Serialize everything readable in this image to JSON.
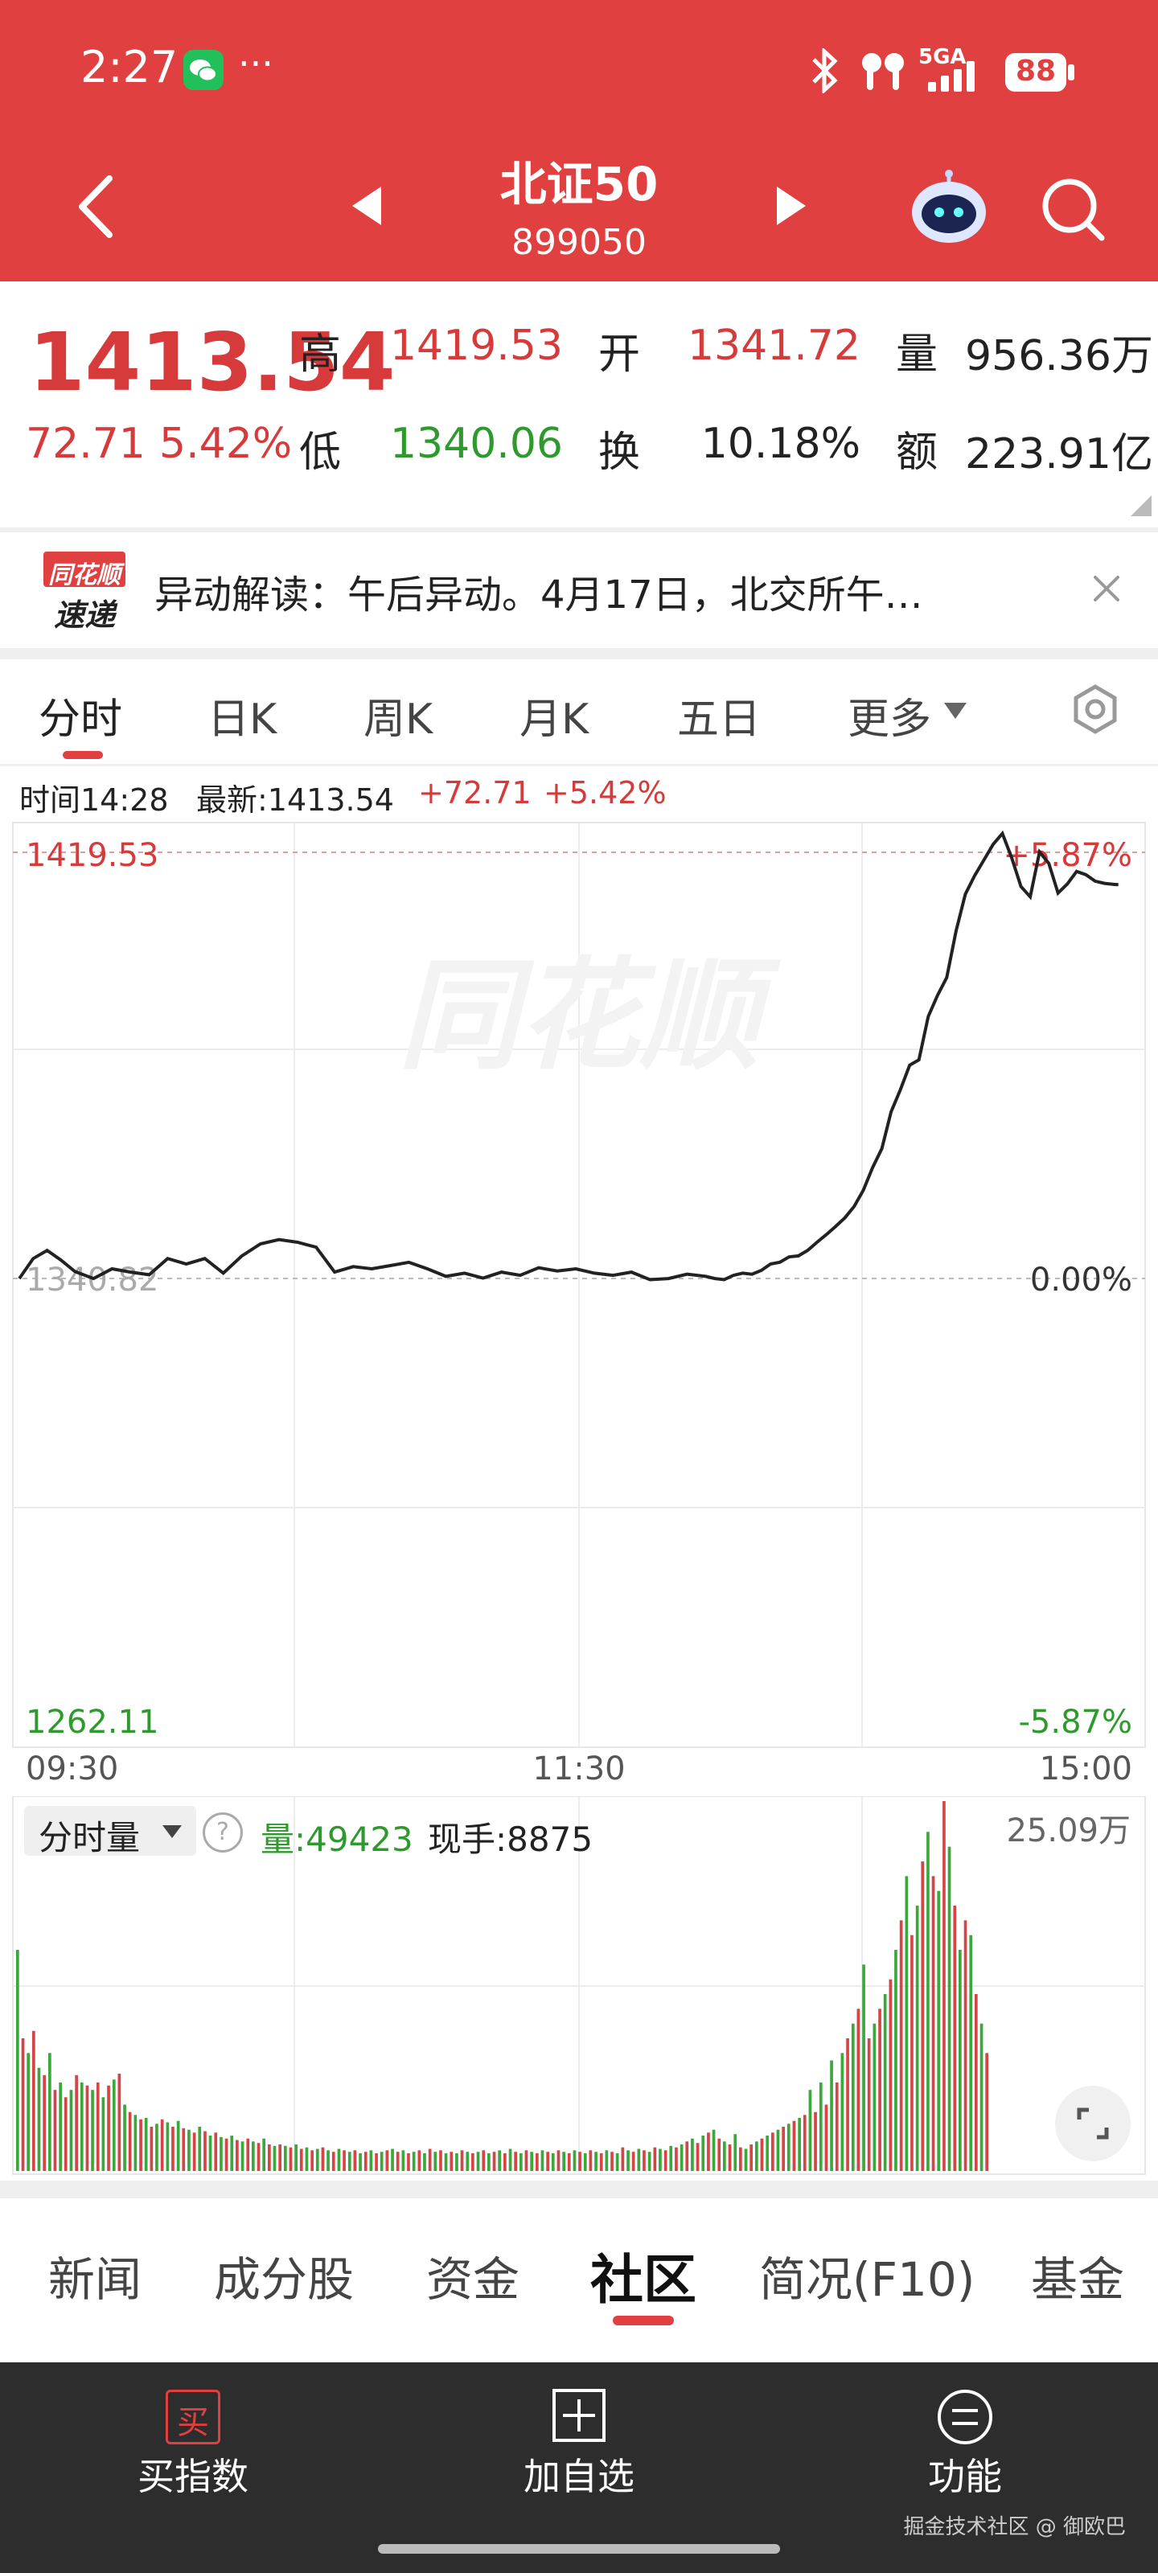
{
  "status_bar": {
    "time": "2:27",
    "more": "···",
    "network": "5GA",
    "battery": "88"
  },
  "header": {
    "title": "北证50",
    "code": "899050"
  },
  "quote": {
    "price": "1413.54",
    "change": "72.71",
    "change_pct": "5.42%",
    "high_label": "高",
    "high": "1419.53",
    "open_label": "开",
    "open": "1341.72",
    "volume_label": "量",
    "volume": "956.36万",
    "low_label": "低",
    "low": "1340.06",
    "turnover_label": "换",
    "turnover": "10.18%",
    "amount_label": "额",
    "amount": "223.91亿"
  },
  "news_banner": {
    "logo_top": "同花顺",
    "logo_bottom": "速递",
    "text": "异动解读：午后异动。4月17日，北交所午…"
  },
  "chart_tabs": [
    "分时",
    "日K",
    "周K",
    "月K",
    "五日",
    "更多"
  ],
  "chart_info": {
    "time": "时间14:28",
    "latest": "最新:1413.54",
    "change": "+72.71",
    "change_pct": "+5.42%"
  },
  "watermark": "同花顺",
  "chart_data": {
    "type": "line",
    "x_ticks": [
      "09:30",
      "11:30",
      "15:00"
    ],
    "y_left_top": "1419.53",
    "y_left_mid": "1340.82",
    "y_left_bottom": "1262.11",
    "y_right_top": "+5.87%",
    "y_right_mid": "0.00%",
    "y_right_bottom": "-5.87%",
    "ylim": [
      1262.11,
      1419.53
    ],
    "baseline": 1340.82,
    "x": [
      0,
      3,
      6,
      9,
      12,
      16,
      20,
      24,
      28,
      32,
      36,
      40,
      44,
      48,
      52,
      56,
      60,
      64,
      68,
      72,
      76,
      80,
      84,
      88,
      92,
      96,
      100,
      104,
      108,
      112,
      116,
      120,
      124,
      128,
      132,
      136,
      140,
      144,
      148,
      150,
      152,
      154,
      156,
      158,
      160,
      162,
      164,
      166,
      168,
      170,
      172,
      174,
      176,
      178,
      180,
      182,
      184,
      186,
      188,
      190,
      192,
      194,
      196,
      198,
      200,
      202,
      204,
      206,
      208,
      210,
      212,
      214,
      216,
      218,
      220,
      222,
      224,
      226,
      228,
      230,
      232,
      234,
      236,
      237
    ],
    "y": [
      1340.8,
      1344.5,
      1346.0,
      1344.2,
      1342.1,
      1340.8,
      1342.6,
      1342.0,
      1341.5,
      1344.5,
      1343.5,
      1344.5,
      1341.8,
      1345.0,
      1347.2,
      1348.0,
      1347.5,
      1346.6,
      1342.0,
      1343.0,
      1342.6,
      1343.2,
      1343.8,
      1342.6,
      1341.2,
      1341.8,
      1340.9,
      1342.0,
      1341.4,
      1342.8,
      1342.2,
      1342.6,
      1341.8,
      1341.4,
      1342.0,
      1340.6,
      1340.8,
      1341.6,
      1341.2,
      1340.8,
      1340.6,
      1341.4,
      1341.8,
      1341.6,
      1342.3,
      1343.5,
      1343.8,
      1344.8,
      1345.0,
      1346.0,
      1347.5,
      1348.9,
      1350.4,
      1352.0,
      1354.1,
      1357.1,
      1361.3,
      1364.8,
      1371.6,
      1375.7,
      1380.2,
      1381.2,
      1389.2,
      1393.1,
      1396.4,
      1405.0,
      1411.8,
      1415.2,
      1418.1,
      1421.0,
      1423.0,
      1418.5,
      1413.2,
      1411.3,
      1419.6,
      1417.5,
      1412.0,
      1413.7,
      1416.0,
      1415.4,
      1414.2,
      1413.8,
      1413.6,
      1413.54
    ]
  },
  "volume_chart": {
    "selector": "分时量",
    "help": "?",
    "volume_label": "量:49423",
    "hand_label": "现手:8875",
    "max_label": "25.09万",
    "max": 250900,
    "bars": [
      150000,
      90000,
      80000,
      95000,
      70000,
      65000,
      80000,
      55000,
      60000,
      50000,
      55000,
      65000,
      60000,
      58000,
      55000,
      60000,
      50000,
      58000,
      62000,
      66000,
      45000,
      40000,
      38000,
      35000,
      36000,
      30000,
      32000,
      35000,
      33000,
      30000,
      34000,
      29000,
      28000,
      26000,
      30000,
      27000,
      24000,
      26000,
      23000,
      22000,
      24000,
      21000,
      20000,
      22000,
      20000,
      19000,
      22000,
      18000,
      17000,
      18000,
      17000,
      16000,
      18000,
      15000,
      16000,
      14000,
      15000,
      16000,
      14000,
      13000,
      15000,
      14000,
      13000,
      14000,
      12000,
      13000,
      14000,
      12000,
      13000,
      14000,
      15000,
      13000,
      14000,
      12000,
      13000,
      14000,
      12000,
      15000,
      13000,
      14000,
      12000,
      13000,
      12000,
      14000,
      13000,
      12000,
      13000,
      14000,
      12000,
      13000,
      14000,
      12000,
      15000,
      13000,
      12000,
      14000,
      13000,
      12000,
      14000,
      13000,
      12000,
      14000,
      13000,
      12000,
      14000,
      13000,
      12000,
      14000,
      13000,
      12000,
      14000,
      13000,
      12000,
      16000,
      14000,
      13000,
      15000,
      14000,
      13000,
      16000,
      15000,
      14000,
      17000,
      16000,
      18000,
      20000,
      22000,
      19000,
      24000,
      26000,
      28000,
      22000,
      20000,
      18000,
      25000,
      16000,
      15000,
      18000,
      20000,
      22000,
      24000,
      26000,
      28000,
      30000,
      32000,
      34000,
      36000,
      38000,
      55000,
      40000,
      60000,
      45000,
      75000,
      60000,
      80000,
      90000,
      100000,
      110000,
      140000,
      90000,
      100000,
      110000,
      120000,
      130000,
      150000,
      170000,
      200000,
      160000,
      180000,
      210000,
      230000,
      200000,
      190000,
      250900,
      220000,
      180000,
      150000,
      170000,
      160000,
      120000,
      100000,
      80000
    ],
    "bar_colors": [
      "green",
      "red"
    ]
  },
  "bottom_tabs": [
    "新闻",
    "成分股",
    "资金",
    "社区",
    "简况(F10)",
    "基金"
  ],
  "active_bottom_tab": "社区",
  "action_bar": {
    "buy_icon_char": "买",
    "buy": "买指数",
    "add": "加自选",
    "func": "功能",
    "footer": "掘金技术社区 @ 御欧巴"
  },
  "colors": {
    "brand_red": "#e04040",
    "up_red": "#d63a3a",
    "down_green": "#2e9a2e"
  }
}
